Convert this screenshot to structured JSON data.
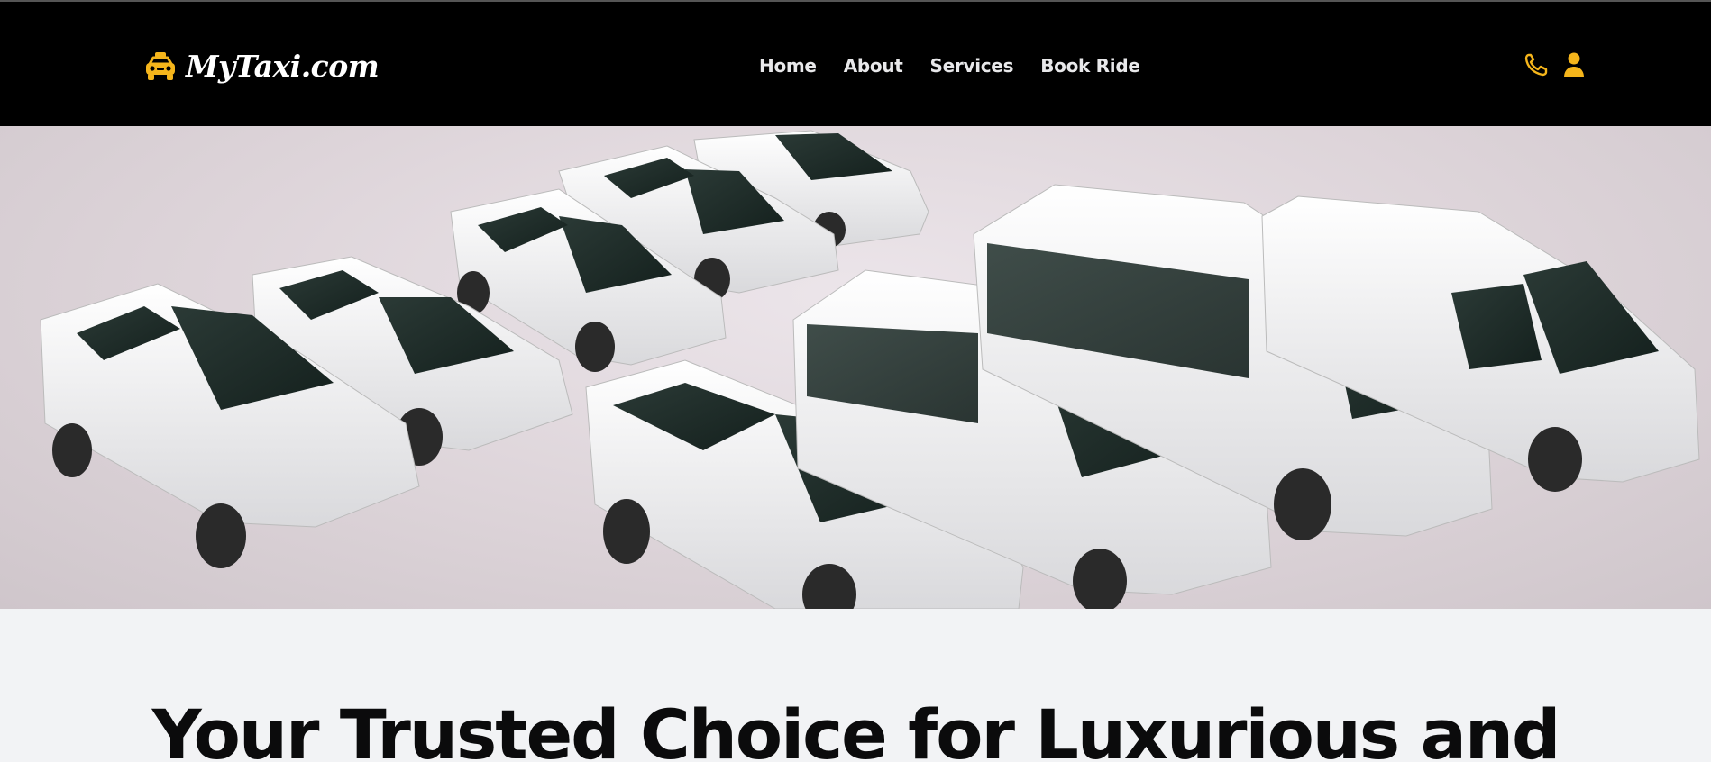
{
  "header": {
    "brand": "MyTaxi.com",
    "brand_icon": "taxi-icon",
    "accent_color": "#f5b51b",
    "nav": [
      {
        "label": "Home"
      },
      {
        "label": "About"
      },
      {
        "label": "Services"
      },
      {
        "label": "Book Ride"
      }
    ],
    "actions": [
      {
        "icon": "phone-icon"
      },
      {
        "icon": "user-icon"
      }
    ]
  },
  "hero": {
    "image": "fleet-of-white-cars-and-vans"
  },
  "main": {
    "headline": "Your Trusted Choice for Luxurious and"
  }
}
